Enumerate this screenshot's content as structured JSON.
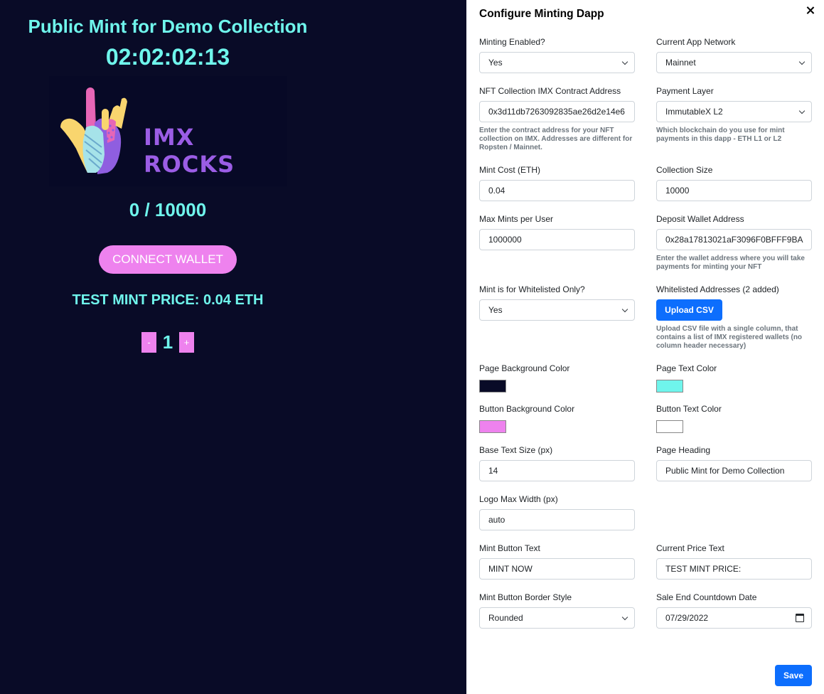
{
  "preview": {
    "heading": "Public Mint for Demo Collection",
    "countdown": "02:02:02:13",
    "logo_text": "IMX ROCKS",
    "mint_count": "0 / 10000",
    "connect_label": "CONNECT WALLET",
    "price_text": "TEST MINT PRICE: 0.04 ETH",
    "decrement": "-",
    "quantity": "1",
    "increment": "+"
  },
  "panel": {
    "title": "Configure Minting Dapp",
    "minting_enabled": {
      "label": "Minting Enabled?",
      "value": "Yes"
    },
    "app_network": {
      "label": "Current App Network",
      "value": "Mainnet"
    },
    "contract_address": {
      "label": "NFT Collection IMX Contract Address",
      "value": "0x3d11db7263092835ae26d2e14e6",
      "help": "Enter the contract address for your NFT collection on IMX. Addresses are different for Ropsten / Mainnet."
    },
    "payment_layer": {
      "label": "Payment Layer",
      "value": "ImmutableX L2",
      "help": "Which blockchain do you use for mint payments in this dapp - ETH L1 or L2"
    },
    "mint_cost": {
      "label": "Mint Cost (ETH)",
      "value": "0.04"
    },
    "collection_size": {
      "label": "Collection Size",
      "value": "10000"
    },
    "max_mints": {
      "label": "Max Mints per User",
      "value": "1000000"
    },
    "deposit_wallet": {
      "label": "Deposit Wallet Address",
      "value": "0x28a17813021aF3096F0BFFF9BA",
      "help": "Enter the wallet address where you will take payments for minting your NFT"
    },
    "whitelist_only": {
      "label": "Mint is for Whitelisted Only?",
      "value": "Yes"
    },
    "whitelisted_addresses": {
      "label": "Whitelisted Addresses (2 added)",
      "button": "Upload CSV",
      "help": "Upload CSV file with a single column, that contains a list of IMX registered wallets (no column header necessary)"
    },
    "page_bg_color": {
      "label": "Page Background Color",
      "value": "#090b27"
    },
    "page_text_color": {
      "label": "Page Text Color",
      "value": "#6ff5ec"
    },
    "button_bg_color": {
      "label": "Button Background Color",
      "value": "#ee82ee"
    },
    "button_text_color": {
      "label": "Button Text Color",
      "value": "#ffffff"
    },
    "base_text_size": {
      "label": "Base Text Size (px)",
      "value": "14"
    },
    "page_heading": {
      "label": "Page Heading",
      "value": "Public Mint for Demo Collection"
    },
    "logo_max_width": {
      "label": "Logo Max Width (px)",
      "value": "auto"
    },
    "mint_button_text": {
      "label": "Mint Button Text",
      "value": "MINT NOW"
    },
    "current_price_text": {
      "label": "Current Price Text",
      "value": "TEST MINT PRICE:"
    },
    "mint_button_border": {
      "label": "Mint Button Border Style",
      "value": "Rounded"
    },
    "sale_end_date": {
      "label": "Sale End Countdown Date",
      "value": "07/29/2022"
    },
    "save_label": "Save"
  },
  "icons": [
    "close-icon",
    "chevron-down-icon",
    "calendar-icon",
    "hand-logo"
  ]
}
